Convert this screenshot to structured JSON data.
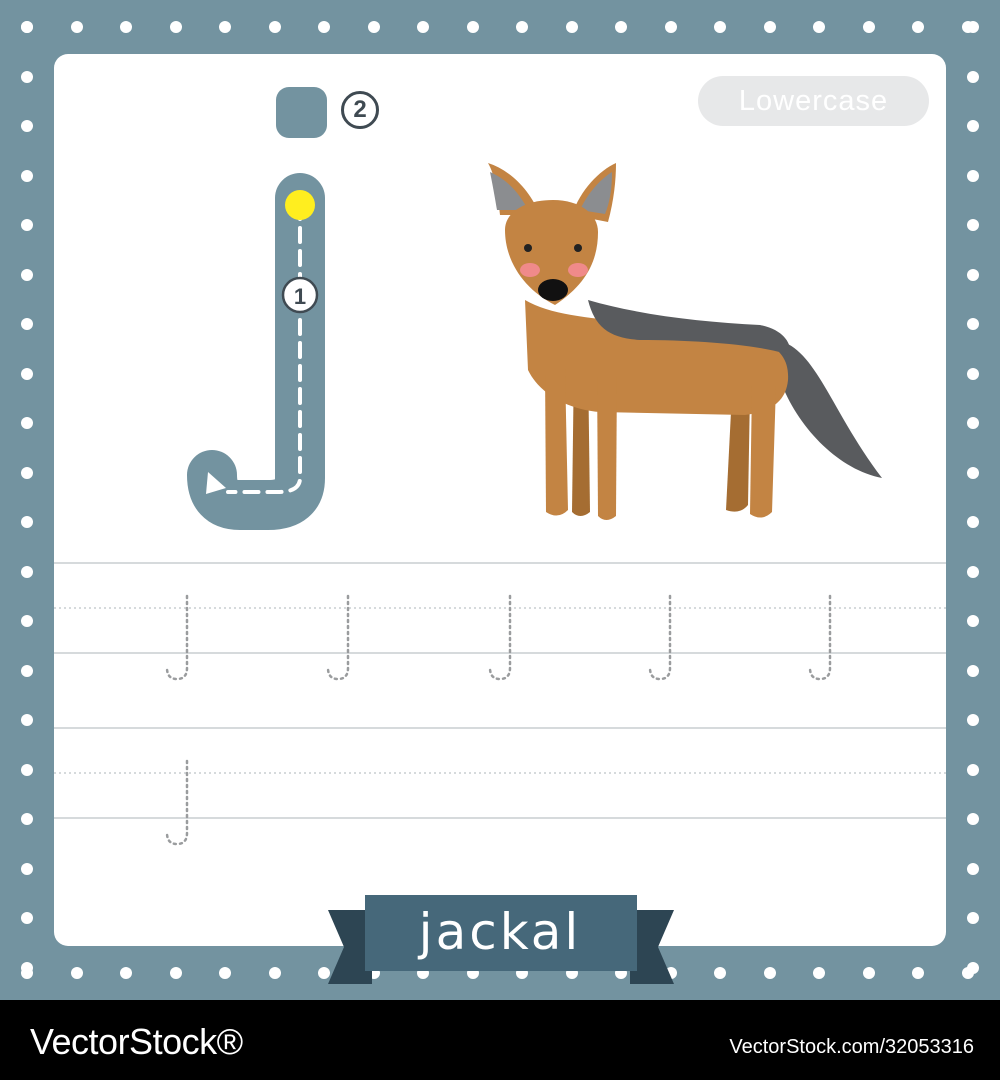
{
  "worksheet": {
    "case_label": "Lowercase",
    "letter": "j",
    "stroke_count": "2",
    "stroke_step": "1",
    "word": "jackal",
    "illustration": "jackal",
    "practice_letters": [
      "j",
      "j",
      "j",
      "j",
      "j",
      "j"
    ]
  },
  "watermark": {
    "brand": "VectorStock®",
    "id": "VectorStock.com/32053316"
  },
  "colors": {
    "frame": "#7393a0",
    "ribbon": "#46687a",
    "ribbon_dark": "#2d4553",
    "start_dot": "#ffee1f",
    "jackal_body": "#c38443",
    "jackal_back": "#595b5e"
  }
}
